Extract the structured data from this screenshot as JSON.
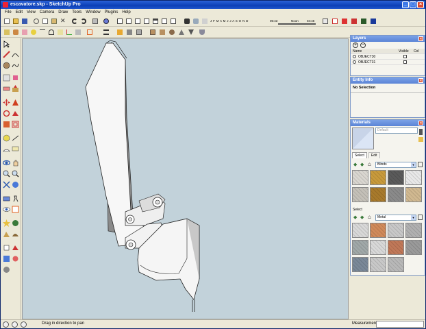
{
  "window": {
    "title": "escavatore.skp - SketchUp Pro"
  },
  "menu": [
    "File",
    "Edit",
    "View",
    "Camera",
    "Draw",
    "Tools",
    "Window",
    "Plugins",
    "Help"
  ],
  "shadow_bar": {
    "months": "J F M A M J J A S O N D",
    "time_start": "06:43",
    "noon": "Noon",
    "time_end": "04:46"
  },
  "layers": {
    "title": "Layers",
    "columns": [
      "Name",
      "Visible",
      "Col"
    ],
    "rows": [
      {
        "name": "OBJECT30"
      },
      {
        "name": "OBJECT31"
      }
    ]
  },
  "entity_info": {
    "title": "Entity Info",
    "selection": "No Selection"
  },
  "materials": {
    "title": "Materials",
    "default_label": "Default",
    "tabs": [
      "Select",
      "Edit"
    ],
    "library_1": "Blinds",
    "section_label": "Select",
    "library_2": "Metal",
    "colors_1": [
      "#d9d6d0",
      "#c89a3c",
      "#5a5a5a",
      "#e8e8e8",
      "#c4c0b8",
      "#a87a2c",
      "#8a8a8a",
      "#d0b890"
    ],
    "colors_2": [
      "#d8d8d8",
      "#d08a5a",
      "#c8c8c8",
      "#b0b0b0",
      "#a0a8a8",
      "#d8d8d8",
      "#c07858",
      "#9a9a9a",
      "#7a8898",
      "#c8c8c8",
      "#b8b8b8"
    ]
  },
  "status": {
    "hint": "Drag in direction to pan",
    "measurements_label": "Measurements",
    "measurements_value": ""
  }
}
